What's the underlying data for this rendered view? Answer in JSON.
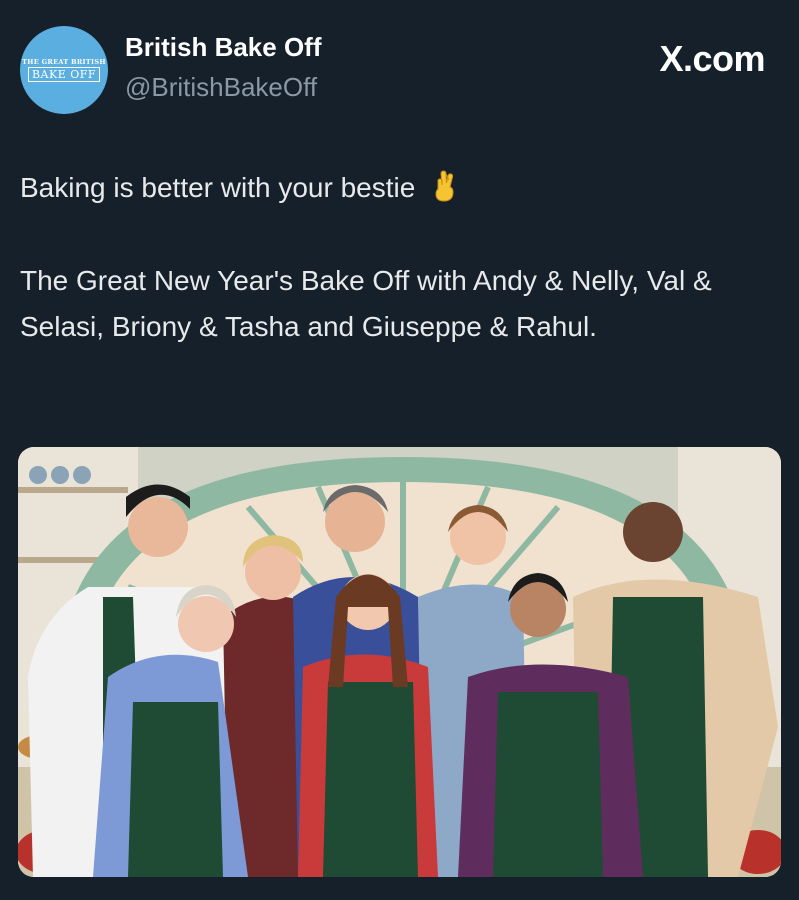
{
  "account": {
    "avatar_line1": "THE GREAT BRITISH",
    "avatar_line2": "BAKE OFF",
    "name": "British Bake Off",
    "handle": "@BritishBakeOff"
  },
  "site": {
    "label": "X.com"
  },
  "post": {
    "line1": "Baking is better with your bestie",
    "line1_emoji": "crossed-fingers-emoji",
    "body": "The Great New Year's Bake Off with Andy & Nelly, Val & Selasi, Briony & Tasha and Giuseppe & Rahul."
  },
  "media": {
    "icon": "group-photo-image"
  },
  "colors": {
    "background": "#15202b",
    "text": "#e7e9ea",
    "muted": "#8b98a5",
    "avatar_bg": "#5aaee0",
    "apron": "#1f4a33"
  }
}
